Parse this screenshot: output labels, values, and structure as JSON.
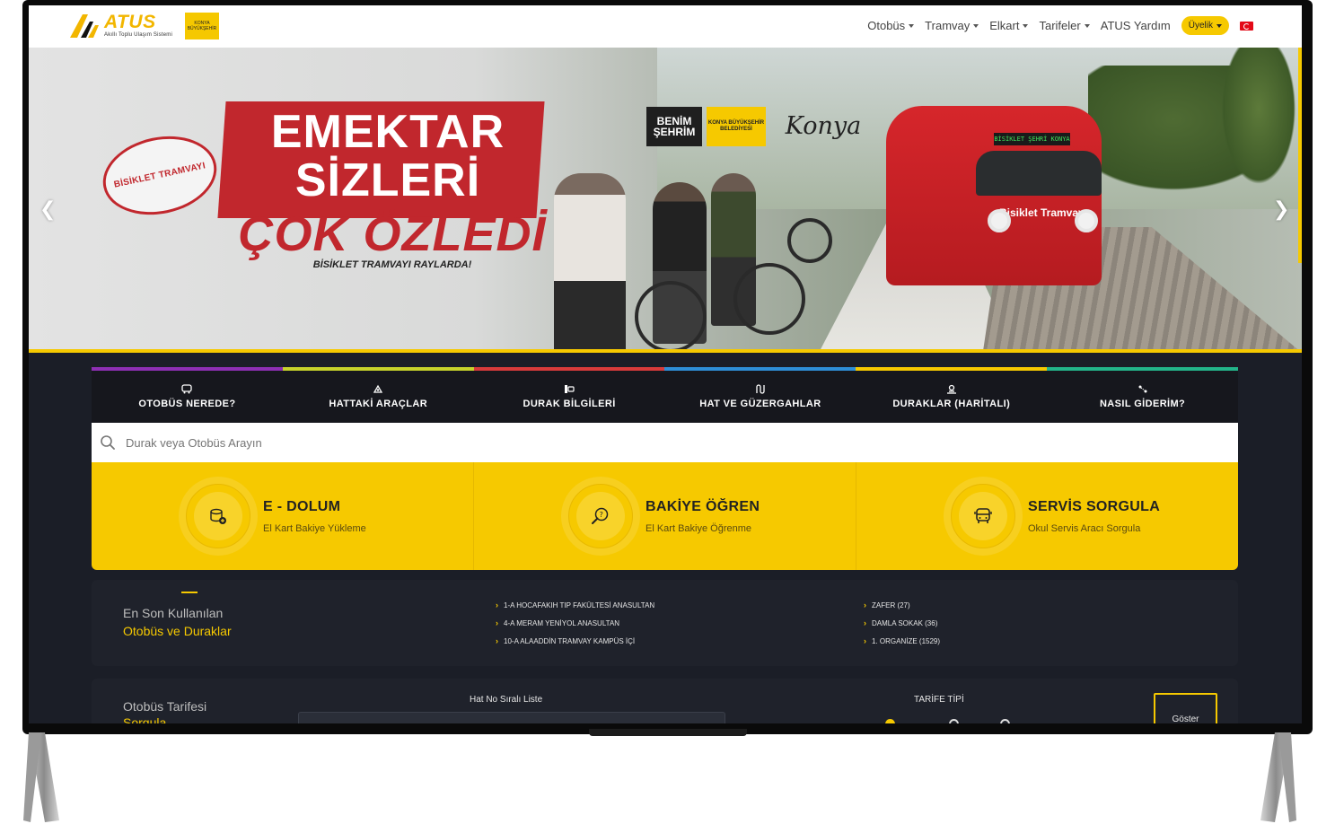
{
  "colors": {
    "accent": "#f6c900",
    "dark": "#1b1e27",
    "hero_red": "#c1272d"
  },
  "header": {
    "brand_name": "ATUS",
    "brand_tagline": "Akıllı Toplu Ulaşım Sistemi",
    "seal_text": "KONYA BÜYÜKŞEHİR",
    "menu": [
      {
        "label": "Otobüs"
      },
      {
        "label": "Tramvay"
      },
      {
        "label": "Elkart"
      },
      {
        "label": "Tarifeler"
      }
    ],
    "help_label": "ATUS Yardım",
    "membership_label": "Üyelik",
    "language_icon": "turkey-flag-icon"
  },
  "hero": {
    "badge_text": "BİSİKLET TRAMVAYI",
    "headline_line1": "EMEKTAR",
    "headline_line2": "SİZLERİ",
    "headline_line3": "ÇOK ÖZLEDİ",
    "headline_tagline": "BİSİKLET TRAMVAYI RAYLARDA!",
    "logo1": "BENİM ŞEHRİM",
    "logo2": "KONYA BÜYÜKŞEHİR BELEDİYESİ",
    "logo3": "Konya",
    "tram_destination": "BİSİKLET ŞEHRİ KONYA",
    "tram_label": "Bisiklet Tramvayı",
    "prev_icon": "chevron-left-icon",
    "next_icon": "chevron-right-icon"
  },
  "tabs": [
    {
      "label": "OTOBÜS NEREDE?",
      "icon": "bus-icon"
    },
    {
      "label": "HATTAKİ ARAÇLAR",
      "icon": "vehicle-icon"
    },
    {
      "label": "DURAK BİLGİLERİ",
      "icon": "bus-stop-icon"
    },
    {
      "label": "HAT VE GÜZERGAHLAR",
      "icon": "route-icon"
    },
    {
      "label": "DURAKLAR (HARİTALI)",
      "icon": "map-pin-icon"
    },
    {
      "label": "NASIL GİDERİM?",
      "icon": "directions-icon"
    }
  ],
  "tab_stripe_colors": [
    "#8e2fb4",
    "#c7d32b",
    "#d83b3b",
    "#2e8fd8",
    "#f6c900",
    "#23b58a"
  ],
  "search": {
    "placeholder": "Durak veya Otobüs Arayın"
  },
  "cards": [
    {
      "title": "E - DOLUM",
      "subtitle": "El Kart Bakiye Yükleme",
      "icon": "card-reload-icon"
    },
    {
      "title": "BAKİYE ÖĞREN",
      "subtitle": "El Kart Bakiye Öğrenme",
      "icon": "balance-search-icon"
    },
    {
      "title": "SERVİS SORGULA",
      "subtitle": "Okul Servis Aracı Sorgula",
      "icon": "bus-front-icon"
    }
  ],
  "recent": {
    "title": "En Son Kullanılan",
    "subtitle": "Otobüs ve Duraklar",
    "lines": [
      "1-A HOCAFAKIH TIP FAKÜLTESİ ANASULTAN",
      "4-A MERAM YENİYOL ANASULTAN",
      "10-A ALAADDİN TRAMVAY KAMPÜS İÇİ"
    ],
    "stops": [
      "ZAFER (27)",
      "DAMLA SOKAK (36)",
      "1. ORGANİZE (1529)"
    ]
  },
  "tariff": {
    "title": "Otobüs Tarifesi",
    "subtitle": "Sorgula",
    "list_label": "Hat No Sıralı Liste",
    "type_label": "TARİFE TİPİ",
    "show_button": "Göster"
  }
}
